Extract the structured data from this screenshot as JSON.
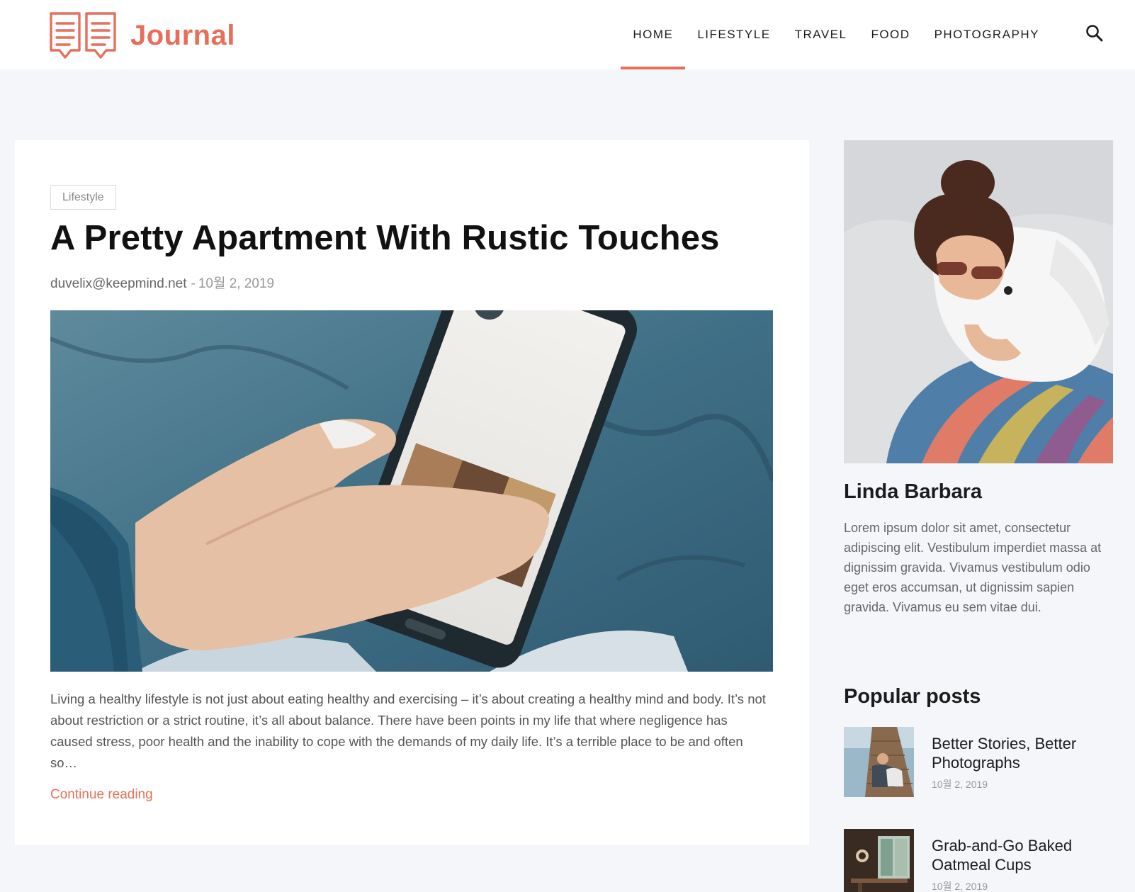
{
  "site": {
    "name": "Journal",
    "logo_icon": "open-book-icon",
    "accent_color": "#e76f5a"
  },
  "nav": {
    "items": [
      {
        "label": "HOME",
        "active": true
      },
      {
        "label": "LIFESTYLE",
        "active": false
      },
      {
        "label": "TRAVEL",
        "active": false
      },
      {
        "label": "FOOD",
        "active": false
      },
      {
        "label": "PHOTOGRAPHY",
        "active": false
      }
    ],
    "search_icon": "search-icon"
  },
  "post": {
    "category": "Lifestyle",
    "title": "A Pretty Apartment With Rustic Touches",
    "author": "duvelix@keepmind.net",
    "separator": "-",
    "date": "10월 2, 2019",
    "image": "hand-holding-smartphone-photo",
    "excerpt": "Living a healthy lifestyle is not just about eating healthy and exercising – it’s about creating a healthy mind and body. It’s not about restriction or a strict routine, it’s all about balance. There have been points in my life that where negligence has caused stress, poor health and the inability to cope with the demands of my daily life. It’s a terrible place to be and often so…",
    "continue_label": "Continue reading"
  },
  "sidebar": {
    "profile": {
      "image": "woman-with-sunglasses-photo",
      "name": "Linda Barbara",
      "bio": "Lorem ipsum dolor sit amet, consectetur adipiscing elit. Vestibulum imperdiet massa at dignissim gravida. Vivamus vestibulum odio eget eros accumsan, ut dignissim sapien gravida. Vivamus eu sem vitae dui."
    },
    "popular": {
      "heading": "Popular posts",
      "items": [
        {
          "title": "Better Stories, Better Photographs",
          "date": "10월 2, 2019",
          "image": "couple-on-dock-photo"
        },
        {
          "title": "Grab-and-Go Baked Oatmeal Cups",
          "date": "10월 2, 2019",
          "image": "cafe-interior-photo"
        }
      ]
    }
  }
}
